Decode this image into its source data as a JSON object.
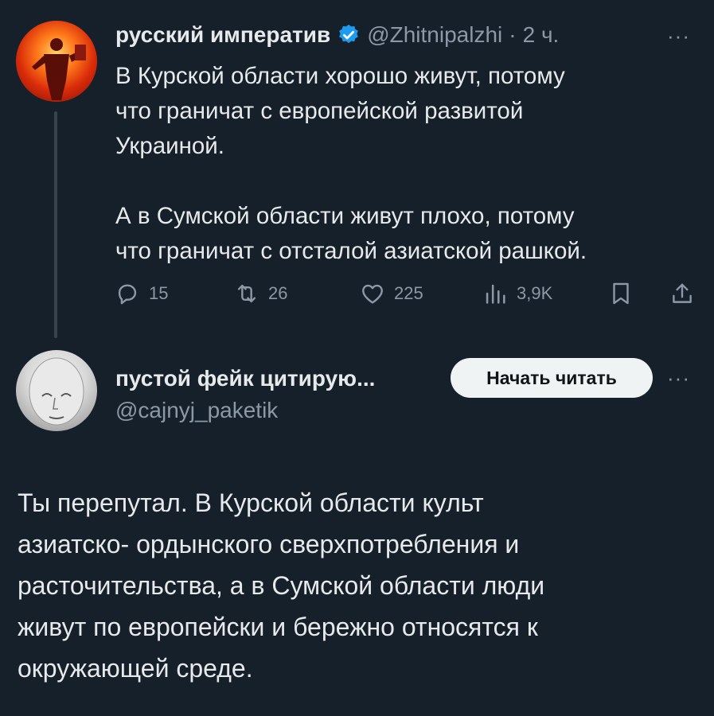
{
  "tweet": {
    "author_name": "русский императив",
    "handle": "@Zhitnipalzhi",
    "separator": "·",
    "time": "2 ч.",
    "text_p1": "В Курской области хорошо живут, потому\nчто граничат с европейской развитой\nУкраиной.",
    "text_p2": "А в Сумской области живут плохо, потому\nчто граничат с отсталой азиатской рашкой.",
    "more": "···",
    "actions": {
      "replies": "15",
      "retweets": "26",
      "likes": "225",
      "views": "3,9K"
    }
  },
  "reply": {
    "author_name": "пустой фейк цитирую...",
    "handle": "@cajnyj_paketik",
    "follow_button": "Начать читать",
    "more": "···",
    "text": "Ты перепутал. В Курской области культ\nазиатско- ордынского сверхпотребления и\nрасточительства, а в Сумской области люди\nживут по европейски и бережно относятся к\nокружающей среде."
  },
  "colors": {
    "background": "#15202b",
    "text": "#e7e9ea",
    "muted": "#8b98a5",
    "verified": "#1d9bf0"
  },
  "icons": [
    "reply-icon",
    "retweet-icon",
    "like-icon",
    "views-icon",
    "bookmark-icon",
    "share-icon",
    "verified-badge-icon"
  ]
}
